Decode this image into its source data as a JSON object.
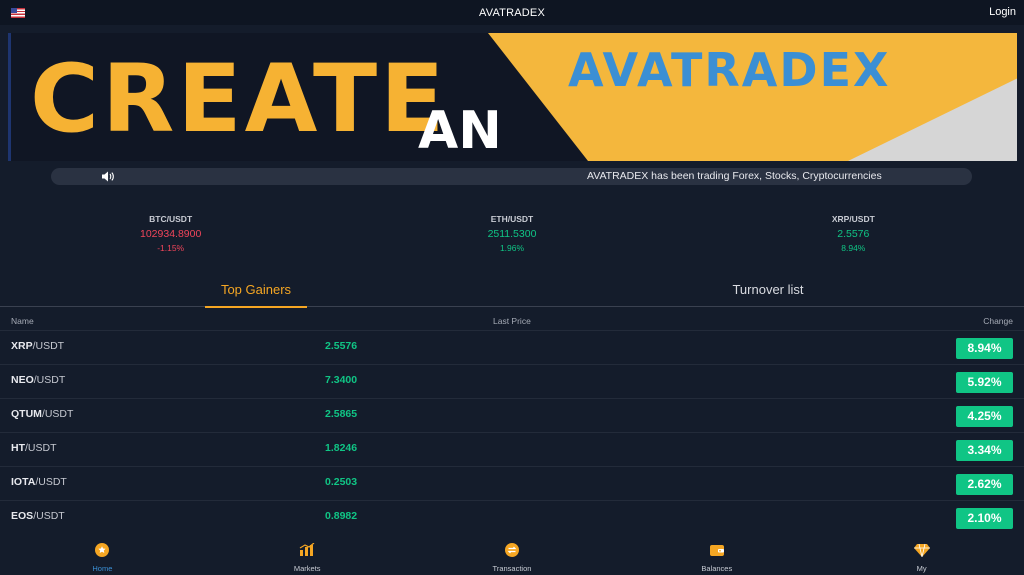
{
  "header": {
    "title": "AVATRADEX",
    "login_label": "Login",
    "flag_icon": "us-flag-icon"
  },
  "banner": {
    "headline": "CREATE",
    "headline_2": "AN",
    "brand": "AVATRADEX"
  },
  "ticker": {
    "message": "AVATRADEX has been trading Forex, Stocks, Cryptocurrencies"
  },
  "pairs": [
    {
      "symbol": "BTC/USDT",
      "price": "102934.8900",
      "change": "-1.15%",
      "trend": "down"
    },
    {
      "symbol": "ETH/USDT",
      "price": "2511.5300",
      "change": "1.96%",
      "trend": "up"
    },
    {
      "symbol": "XRP/USDT",
      "price": "2.5576",
      "change": "8.94%",
      "trend": "up"
    }
  ],
  "tabs": {
    "active": "Top Gainers",
    "inactive": "Turnover list"
  },
  "columns": {
    "name": "Name",
    "last_price": "Last Price",
    "change": "Change"
  },
  "rows": [
    {
      "base": "XRP",
      "quote": "/USDT",
      "last": "2.5576",
      "change": "8.94%"
    },
    {
      "base": "NEO",
      "quote": "/USDT",
      "last": "7.3400",
      "change": "5.92%"
    },
    {
      "base": "QTUM",
      "quote": "/USDT",
      "last": "2.5865",
      "change": "4.25%"
    },
    {
      "base": "HT",
      "quote": "/USDT",
      "last": "1.8246",
      "change": "3.34%"
    },
    {
      "base": "IOTA",
      "quote": "/USDT",
      "last": "0.2503",
      "change": "2.62%"
    },
    {
      "base": "EOS",
      "quote": "/USDT",
      "last": "0.8982",
      "change": "2.10%"
    }
  ],
  "nav": [
    {
      "label": "Home",
      "icon": "home-icon",
      "active": true
    },
    {
      "label": "Markets",
      "icon": "markets-icon",
      "active": false
    },
    {
      "label": "Transaction",
      "icon": "transaction-icon",
      "active": false
    },
    {
      "label": "Balances",
      "icon": "wallet-icon",
      "active": false
    },
    {
      "label": "My",
      "icon": "diamond-icon",
      "active": false
    }
  ],
  "colors": {
    "accent": "#f5a623",
    "up": "#10c585",
    "down": "#f0455a",
    "background": "#141c2b",
    "nav_active": "#3b8fd4"
  }
}
